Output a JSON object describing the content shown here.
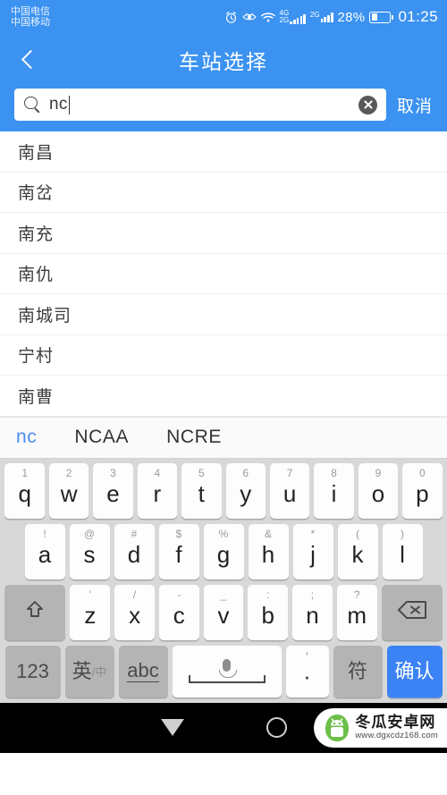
{
  "theme": {
    "primary": "#3b92f0",
    "accent_blue": "#3b82f5",
    "keyboard_bg": "#d8d8d8"
  },
  "statusbar": {
    "carrier1": "中国电信",
    "carrier2": "中国移动",
    "icons": [
      "alarm-icon",
      "eye-icon",
      "wifi-icon"
    ],
    "sim1_net": "4G",
    "sim1_net_alt": "2G",
    "sim2_net": "2G",
    "battery_percent": "28%",
    "time": "01:25"
  },
  "appbar": {
    "title": "车站选择",
    "back_icon": "chevron-left-icon"
  },
  "search": {
    "value": "nc",
    "placeholder": "",
    "search_icon": "search-icon",
    "clear_icon": "clear-circle-icon",
    "cancel_label": "取消"
  },
  "results": [
    {
      "name": "南昌"
    },
    {
      "name": "南岔"
    },
    {
      "name": "南充"
    },
    {
      "name": "南仇"
    },
    {
      "name": "南城司"
    },
    {
      "name": "宁村"
    },
    {
      "name": "南曹"
    }
  ],
  "candidates": [
    {
      "text": "nc",
      "active": true
    },
    {
      "text": "NCAA",
      "active": false
    },
    {
      "text": "NCRE",
      "active": false
    }
  ],
  "keyboard": {
    "row1": [
      {
        "main": "q",
        "hint": "1"
      },
      {
        "main": "w",
        "hint": "2"
      },
      {
        "main": "e",
        "hint": "3"
      },
      {
        "main": "r",
        "hint": "4"
      },
      {
        "main": "t",
        "hint": "5"
      },
      {
        "main": "y",
        "hint": "6"
      },
      {
        "main": "u",
        "hint": "7"
      },
      {
        "main": "i",
        "hint": "8"
      },
      {
        "main": "o",
        "hint": "9"
      },
      {
        "main": "p",
        "hint": "0"
      }
    ],
    "row2": [
      {
        "main": "a",
        "hint": "!"
      },
      {
        "main": "s",
        "hint": "@"
      },
      {
        "main": "d",
        "hint": "#"
      },
      {
        "main": "f",
        "hint": "$"
      },
      {
        "main": "g",
        "hint": "%"
      },
      {
        "main": "h",
        "hint": "&"
      },
      {
        "main": "j",
        "hint": "*"
      },
      {
        "main": "k",
        "hint": "("
      },
      {
        "main": "l",
        "hint": ")"
      }
    ],
    "row3": {
      "shift_icon": "shift-arrow-icon",
      "keys": [
        {
          "main": "z",
          "hint": "'"
        },
        {
          "main": "x",
          "hint": "/"
        },
        {
          "main": "c",
          "hint": "-"
        },
        {
          "main": "v",
          "hint": "_"
        },
        {
          "main": "b",
          "hint": ":"
        },
        {
          "main": "n",
          "hint": ";"
        },
        {
          "main": "m",
          "hint": "?"
        }
      ],
      "backspace_icon": "backspace-icon"
    },
    "row4": {
      "num_label": "123",
      "lang_label": "英",
      "lang_sub": "/中",
      "abc_label": "abc",
      "space_icon": "microphone-icon",
      "dot_main": "·",
      "dot_hint": "'",
      "symbol_label": "符",
      "enter_label": "确认"
    }
  },
  "navbar": {
    "back_icon": "nav-back-triangle-icon",
    "home_icon": "nav-home-circle-icon",
    "watermark_logo": "android-melon-logo-icon",
    "watermark_title": "冬瓜安卓网",
    "watermark_url": "www.dgxcdz168.com"
  }
}
